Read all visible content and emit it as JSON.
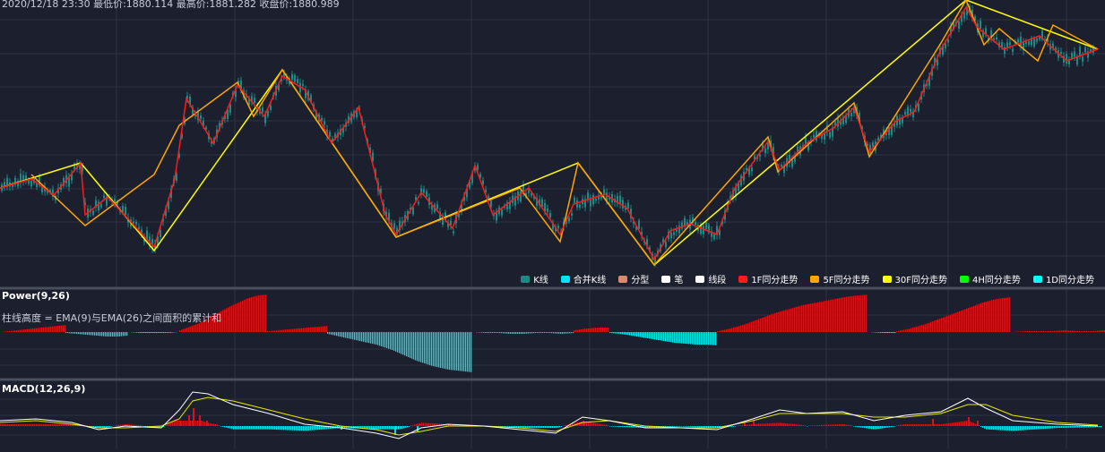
{
  "info_bar": {
    "text": "2020/12/18 23:30  最低价:1880.114  最高价:1881.282  收盘价:1880.989"
  },
  "power_panel": {
    "title": "Power(9,26)",
    "description": "柱线高度 = EMA(9)与EMA(26)之间面积的累计和"
  },
  "macd_panel": {
    "title": "MACD(12,26,9)"
  },
  "colors": {
    "background": "#1c1f2e",
    "grid": "#2c3142",
    "separator": "#4a4f5c",
    "candle": "#1e8a86",
    "bi": "#ffffff",
    "xianduan": "#ffffff",
    "f1": "#ff1a1a",
    "f5": "#ffa500",
    "f30": "#ffff00",
    "h4": "#00ff00",
    "d1": "#00ffff",
    "power_up": "#d0161a",
    "power_down": "#00e0e0",
    "dif": "#ffffff",
    "dea": "#e8e800"
  },
  "legend": [
    {
      "label": "K线",
      "color": "#1e8a86"
    },
    {
      "label": "合并K线",
      "color": "#00e5ff"
    },
    {
      "label": "分型",
      "color": "#d88a6a"
    },
    {
      "label": "笔",
      "color": "#ffffff"
    },
    {
      "label": "线段",
      "color": "#ffffff"
    },
    {
      "label": "1F同分走势",
      "color": "#ff1a1a"
    },
    {
      "label": "5F同分走势",
      "color": "#ffa500"
    },
    {
      "label": "30F同分走势",
      "color": "#ffff00"
    },
    {
      "label": "4H同分走势",
      "color": "#00ff00"
    },
    {
      "label": "1D同分走势",
      "color": "#00ffff"
    }
  ],
  "chart_data": [
    {
      "type": "line",
      "name": "price",
      "x_range": [
        0,
        1233
      ],
      "series": [
        {
          "key": "f30",
          "points": [
            [
              0,
              210
            ],
            [
              90,
              182
            ],
            [
              172,
              280
            ],
            [
              315,
              78
            ],
            [
              442,
              265
            ],
            [
              645,
              182
            ],
            [
              730,
              296
            ],
            [
              1078,
              0
            ],
            [
              1225,
              55
            ]
          ]
        },
        {
          "key": "f5",
          "points": [
            [
              35,
              195
            ],
            [
              95,
              252
            ],
            [
              172,
              195
            ],
            [
              200,
              140
            ],
            [
              265,
              92
            ],
            [
              283,
              130
            ],
            [
              315,
              78
            ],
            [
              442,
              265
            ],
            [
              580,
              210
            ],
            [
              625,
              270
            ],
            [
              645,
              182
            ],
            [
              730,
              296
            ],
            [
              857,
              153
            ],
            [
              868,
              192
            ],
            [
              953,
              115
            ],
            [
              970,
              175
            ],
            [
              1050,
              48
            ],
            [
              1078,
              0
            ],
            [
              1098,
              50
            ],
            [
              1115,
              32
            ],
            [
              1158,
              68
            ],
            [
              1175,
              28
            ],
            [
              1225,
              55
            ]
          ]
        },
        {
          "key": "f1",
          "points": [
            [
              0,
              210
            ],
            [
              35,
              200
            ],
            [
              60,
              218
            ],
            [
              90,
              182
            ],
            [
              95,
              240
            ],
            [
              120,
              220
            ],
            [
              172,
              276
            ],
            [
              195,
              200
            ],
            [
              208,
              110
            ],
            [
              238,
              160
            ],
            [
              265,
              95
            ],
            [
              295,
              130
            ],
            [
              315,
              85
            ],
            [
              340,
              100
            ],
            [
              370,
              160
            ],
            [
              400,
              120
            ],
            [
              430,
              240
            ],
            [
              442,
              262
            ],
            [
              470,
              215
            ],
            [
              505,
              255
            ],
            [
              530,
              185
            ],
            [
              550,
              240
            ],
            [
              590,
              210
            ],
            [
              625,
              262
            ],
            [
              640,
              228
            ],
            [
              675,
              217
            ],
            [
              700,
              233
            ],
            [
              730,
              290
            ],
            [
              748,
              258
            ],
            [
              770,
              250
            ],
            [
              800,
              262
            ],
            [
              820,
              210
            ],
            [
              857,
              158
            ],
            [
              870,
              190
            ],
            [
              900,
              160
            ],
            [
              930,
              143
            ],
            [
              953,
              120
            ],
            [
              970,
              170
            ],
            [
              1000,
              135
            ],
            [
              1020,
              125
            ],
            [
              1050,
              55
            ],
            [
              1078,
              8
            ],
            [
              1090,
              30
            ],
            [
              1120,
              55
            ],
            [
              1160,
              40
            ],
            [
              1190,
              68
            ],
            [
              1225,
              55
            ]
          ]
        }
      ]
    },
    {
      "type": "bar",
      "name": "power",
      "baseline_y": 371,
      "segments": [
        {
          "x0": 0,
          "x1": 73,
          "sign": 1,
          "heights": [
            0,
            1,
            2,
            3,
            4,
            5,
            6,
            7,
            8
          ]
        },
        {
          "x0": 73,
          "x1": 142,
          "sign": -1,
          "heights": [
            1,
            2,
            3,
            4,
            5,
            5,
            4
          ]
        },
        {
          "x0": 142,
          "x1": 200,
          "sign": -1,
          "heights": [
            0,
            1,
            1,
            1,
            0
          ]
        },
        {
          "x0": 200,
          "x1": 298,
          "sign": 1,
          "heights": [
            2,
            6,
            10,
            16,
            22,
            28,
            33,
            38,
            41,
            42
          ]
        },
        {
          "x0": 298,
          "x1": 365,
          "sign": 1,
          "heights": [
            1,
            2,
            3,
            4,
            5,
            6,
            7
          ]
        },
        {
          "x0": 365,
          "x1": 527,
          "sign": -1,
          "heights": [
            2,
            4,
            6,
            8,
            10,
            12,
            14,
            17,
            20,
            24,
            28,
            32,
            35,
            38,
            40,
            42,
            43,
            44,
            45
          ]
        },
        {
          "x0": 527,
          "x1": 640,
          "sign": -1,
          "heights": [
            0,
            1,
            1,
            2,
            2,
            1,
            1,
            2,
            1
          ]
        },
        {
          "x0": 640,
          "x1": 680,
          "sign": 1,
          "heights": [
            2,
            4,
            5,
            5
          ]
        },
        {
          "x0": 680,
          "x1": 800,
          "sign": -1,
          "heights": [
            1,
            2,
            4,
            6,
            8,
            10,
            12,
            13,
            14,
            14,
            15
          ]
        },
        {
          "x0": 800,
          "x1": 968,
          "sign": 1,
          "heights": [
            1,
            3,
            6,
            9,
            13,
            17,
            21,
            24,
            27,
            30,
            32,
            34,
            36,
            38,
            40,
            41,
            42
          ]
        },
        {
          "x0": 968,
          "x1": 1000,
          "sign": -1,
          "heights": [
            0,
            1,
            1
          ]
        },
        {
          "x0": 1000,
          "x1": 1128,
          "sign": 1,
          "heights": [
            1,
            3,
            6,
            9,
            13,
            17,
            21,
            25,
            29,
            33,
            36,
            38,
            39
          ]
        },
        {
          "x0": 1128,
          "x1": 1233,
          "sign": 1,
          "heights": [
            0,
            1,
            1,
            1,
            2,
            1,
            1,
            2
          ]
        }
      ]
    },
    {
      "type": "line",
      "name": "macd",
      "baseline_y": 476,
      "dif": [
        [
          0,
          470
        ],
        [
          40,
          468
        ],
        [
          80,
          472
        ],
        [
          110,
          480
        ],
        [
          140,
          476
        ],
        [
          180,
          478
        ],
        [
          200,
          458
        ],
        [
          215,
          438
        ],
        [
          232,
          440
        ],
        [
          260,
          452
        ],
        [
          300,
          462
        ],
        [
          340,
          474
        ],
        [
          380,
          478
        ],
        [
          420,
          484
        ],
        [
          445,
          490
        ],
        [
          470,
          478
        ],
        [
          500,
          474
        ],
        [
          540,
          476
        ],
        [
          580,
          480
        ],
        [
          620,
          484
        ],
        [
          650,
          466
        ],
        [
          680,
          470
        ],
        [
          720,
          478
        ],
        [
          760,
          478
        ],
        [
          800,
          480
        ],
        [
          840,
          468
        ],
        [
          870,
          458
        ],
        [
          900,
          462
        ],
        [
          940,
          460
        ],
        [
          975,
          470
        ],
        [
          1010,
          464
        ],
        [
          1050,
          460
        ],
        [
          1080,
          445
        ],
        [
          1100,
          456
        ],
        [
          1130,
          470
        ],
        [
          1180,
          474
        ],
        [
          1225,
          476
        ]
      ],
      "dea": [
        [
          0,
          472
        ],
        [
          40,
          470
        ],
        [
          80,
          474
        ],
        [
          110,
          478
        ],
        [
          140,
          478
        ],
        [
          180,
          476
        ],
        [
          200,
          468
        ],
        [
          215,
          448
        ],
        [
          232,
          444
        ],
        [
          260,
          448
        ],
        [
          300,
          458
        ],
        [
          340,
          468
        ],
        [
          380,
          476
        ],
        [
          420,
          480
        ],
        [
          445,
          486
        ],
        [
          470,
          482
        ],
        [
          500,
          476
        ],
        [
          540,
          476
        ],
        [
          580,
          478
        ],
        [
          620,
          482
        ],
        [
          650,
          472
        ],
        [
          680,
          470
        ],
        [
          720,
          476
        ],
        [
          760,
          478
        ],
        [
          800,
          478
        ],
        [
          840,
          470
        ],
        [
          870,
          462
        ],
        [
          900,
          462
        ],
        [
          940,
          462
        ],
        [
          975,
          466
        ],
        [
          1010,
          466
        ],
        [
          1050,
          462
        ],
        [
          1080,
          452
        ],
        [
          1100,
          452
        ],
        [
          1130,
          464
        ],
        [
          1180,
          472
        ],
        [
          1225,
          475
        ]
      ],
      "bars": [
        [
          200,
          470
        ],
        [
          210,
          464
        ],
        [
          215,
          456
        ],
        [
          222,
          464
        ],
        [
          230,
          470
        ],
        [
          380,
          480
        ],
        [
          440,
          486
        ],
        [
          465,
          482
        ],
        [
          650,
          470
        ],
        [
          830,
          472
        ],
        [
          840,
          470
        ],
        [
          1040,
          468
        ],
        [
          1080,
          466
        ],
        [
          1090,
          470
        ]
      ]
    }
  ]
}
